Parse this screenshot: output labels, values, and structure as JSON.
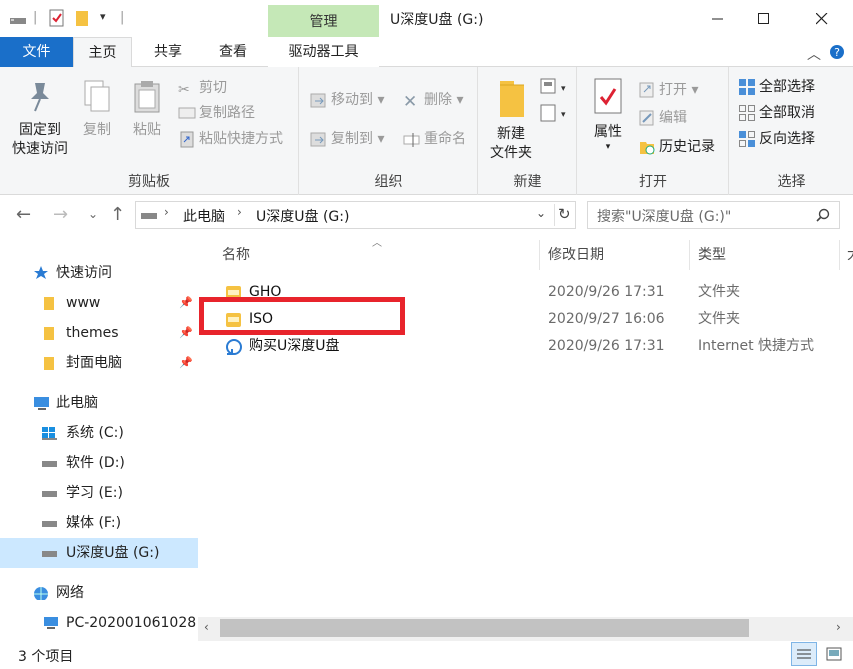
{
  "window": {
    "title": "U深度U盘 (G:)",
    "context_tab": "管理"
  },
  "tabs": {
    "file": "文件",
    "home": "主页",
    "share": "共享",
    "view": "查看",
    "drive_tools": "驱动器工具"
  },
  "ribbon": {
    "clipboard": {
      "label": "剪贴板",
      "pin_quick_access": "固定到\n快速访问",
      "pin_line1": "固定到",
      "pin_line2": "快速访问",
      "copy": "复制",
      "paste": "粘贴",
      "cut": "剪切",
      "copy_path": "复制路径",
      "paste_shortcut": "粘贴快捷方式"
    },
    "organize": {
      "label": "组织",
      "move_to": "移动到",
      "copy_to": "复制到",
      "delete": "删除",
      "rename": "重命名"
    },
    "new": {
      "label": "新建",
      "new_folder_line1": "新建",
      "new_folder_line2": "文件夹"
    },
    "open": {
      "label": "打开",
      "properties": "属性",
      "open": "打开",
      "edit": "编辑",
      "history": "历史记录"
    },
    "select": {
      "label": "选择",
      "select_all": "全部选择",
      "select_none": "全部取消",
      "invert_selection": "反向选择"
    }
  },
  "address": {
    "breadcrumb": [
      "此电脑",
      "U深度U盘 (G:)"
    ],
    "search_placeholder": "搜索\"U深度U盘 (G:)\""
  },
  "nav": {
    "quick_access": "快速访问",
    "pinned": [
      "www",
      "themes",
      "封面电脑"
    ],
    "this_pc": "此电脑",
    "drives": [
      "系统 (C:)",
      "软件 (D:)",
      "学习 (E:)",
      "媒体 (F:)",
      "U深度U盘 (G:)"
    ],
    "network": "网络",
    "network_pc": "PC-202001061028"
  },
  "columns": {
    "name": "名称",
    "date": "修改日期",
    "type": "类型",
    "extra": "大"
  },
  "files": [
    {
      "name": "GHO",
      "date": "2020/9/26 17:31",
      "type": "文件夹"
    },
    {
      "name": "ISO",
      "date": "2020/9/27 16:06",
      "type": "文件夹"
    },
    {
      "name": "购买U深度U盘",
      "date": "2020/9/26 17:31",
      "type": "Internet 快捷方式"
    }
  ],
  "status": {
    "item_count": "3 个项目"
  },
  "colors": {
    "file_tab": "#1a6fc9",
    "manage_tab": "#c5e8b7",
    "selected_nav": "#cce8ff",
    "highlight_box": "#e8242c",
    "folder": "#f5c242"
  }
}
